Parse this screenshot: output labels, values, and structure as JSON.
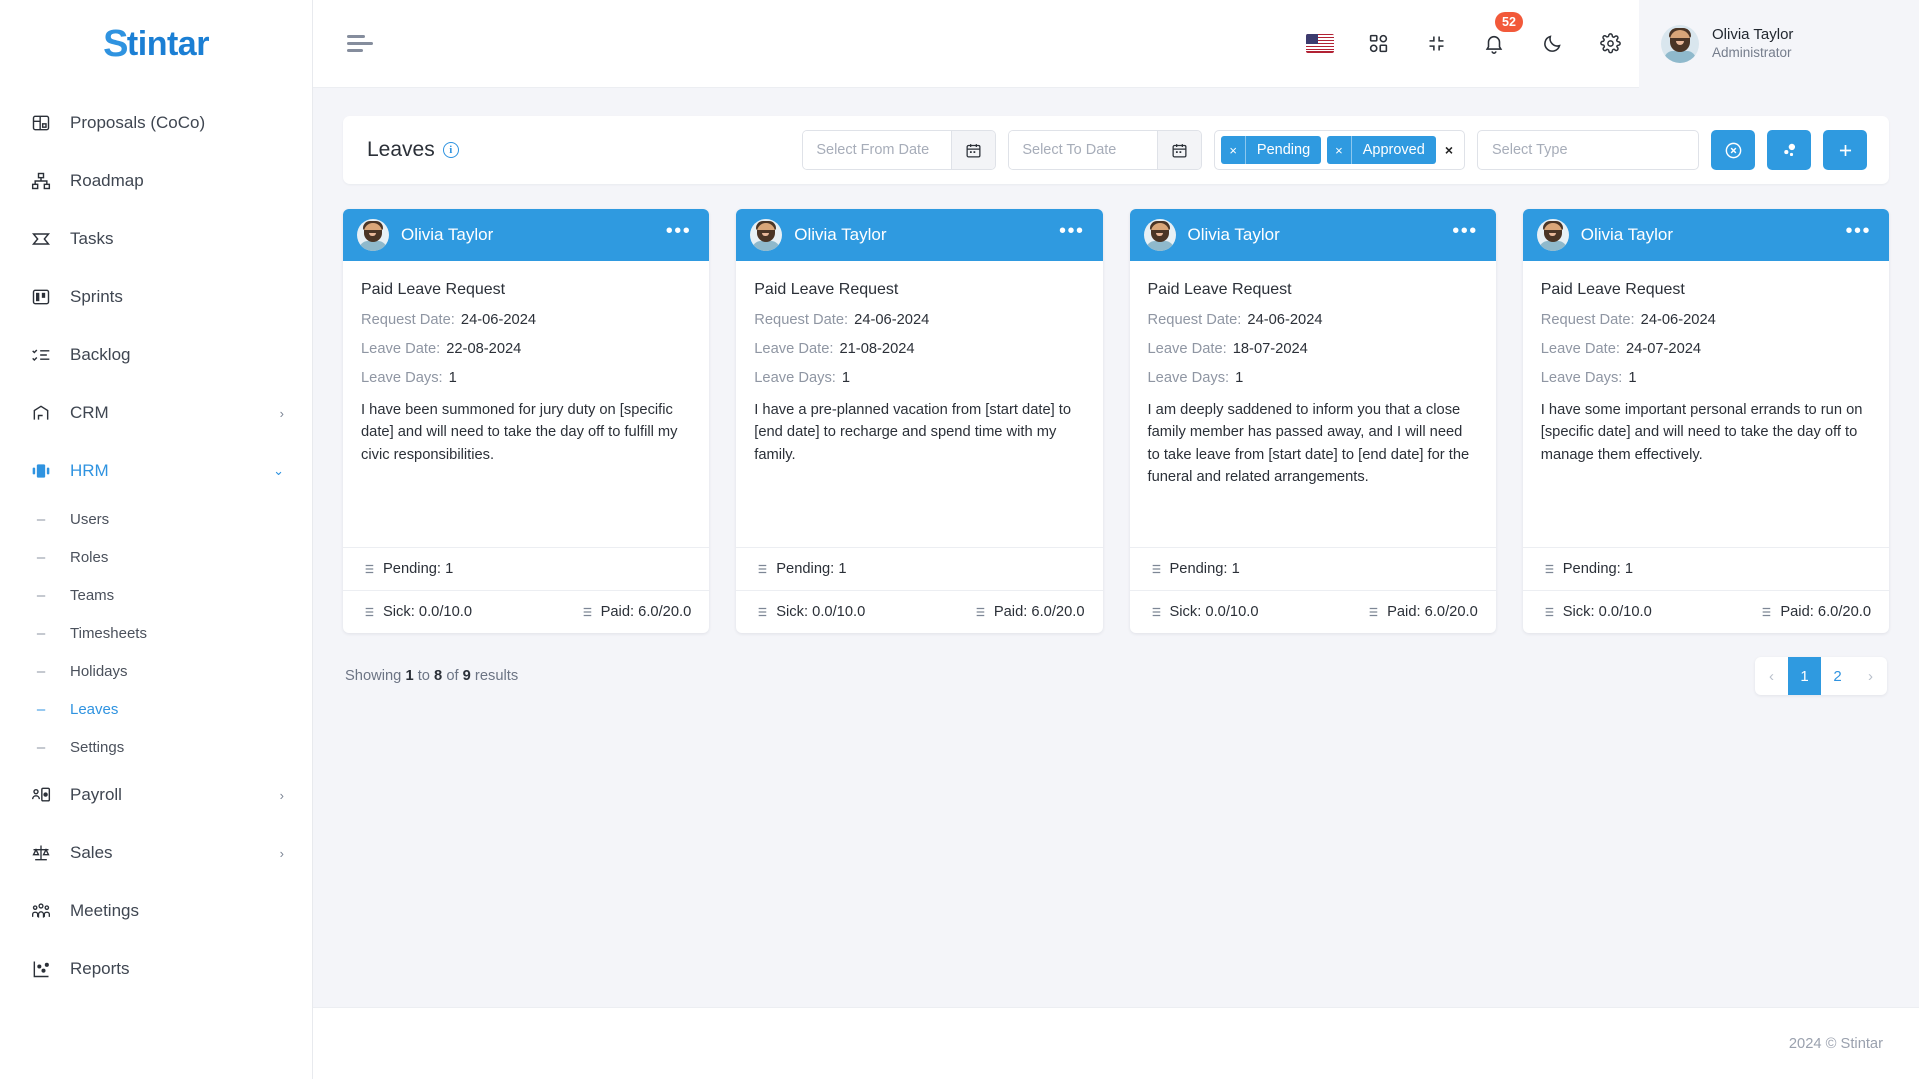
{
  "brand": {
    "name": "Stintar",
    "initial": "S",
    "rest": "tintar"
  },
  "sidebar": {
    "items": [
      {
        "label": "Proposals (CoCo)",
        "icon": "proposals-icon",
        "chevron": ""
      },
      {
        "label": "Roadmap",
        "icon": "roadmap-icon",
        "chevron": ""
      },
      {
        "label": "Tasks",
        "icon": "tasks-icon",
        "chevron": ""
      },
      {
        "label": "Sprints",
        "icon": "sprints-icon",
        "chevron": ""
      },
      {
        "label": "Backlog",
        "icon": "backlog-icon",
        "chevron": ""
      },
      {
        "label": "CRM",
        "icon": "crm-icon",
        "chevron": "›"
      },
      {
        "label": "HRM",
        "icon": "hrm-icon",
        "chevron": "⌄"
      }
    ],
    "hrm_children": [
      {
        "label": "Users"
      },
      {
        "label": "Roles"
      },
      {
        "label": "Teams"
      },
      {
        "label": "Timesheets"
      },
      {
        "label": "Holidays"
      },
      {
        "label": "Leaves"
      },
      {
        "label": "Settings"
      }
    ],
    "items_after": [
      {
        "label": "Payroll",
        "icon": "payroll-icon",
        "chevron": "›"
      },
      {
        "label": "Sales",
        "icon": "sales-icon",
        "chevron": "›"
      },
      {
        "label": "Meetings",
        "icon": "meetings-icon",
        "chevron": ""
      },
      {
        "label": "Reports",
        "icon": "reports-icon",
        "chevron": ""
      }
    ],
    "active_item": "HRM",
    "active_child": "Leaves"
  },
  "topbar": {
    "menu_toggle": "menu-toggle",
    "icons": [
      "flag-us-icon",
      "apps-grid-icon",
      "fullscreen-exit-icon",
      "bell-icon",
      "moon-icon",
      "gear-icon"
    ],
    "notification_count": "52",
    "user": {
      "name": "Olivia Taylor",
      "role": "Administrator"
    }
  },
  "filterbar": {
    "title": "Leaves",
    "info_glyph": "i",
    "from_date_placeholder": "Select From Date",
    "from_date_value": "",
    "to_date_placeholder": "Select To Date",
    "to_date_value": "",
    "status_chips": [
      {
        "label": "Pending",
        "remove": "×"
      },
      {
        "label": "Approved",
        "remove": "×"
      }
    ],
    "clear_all": "×",
    "type_placeholder": "Select Type",
    "type_value": "",
    "buttons": [
      {
        "name": "reset-filter-button",
        "icon": "circle-x-icon"
      },
      {
        "name": "group-filter-button",
        "icon": "bubbles-icon"
      },
      {
        "name": "add-leave-button",
        "icon": "plus-icon"
      }
    ],
    "accent": "#2f9ae0"
  },
  "cards": [
    {
      "user": "Olivia Taylor",
      "menu": "•••",
      "leave_type": "Paid Leave Request",
      "request_date_label": "Request Date:",
      "request_date": "24-06-2024",
      "leave_date_label": "Leave Date:",
      "leave_date": "22-08-2024",
      "leave_days_label": "Leave Days:",
      "leave_days": "1",
      "reason": "I have been summoned for jury duty on [specific date] and will need to take the day off to fulfill my civic responsibilities.",
      "pending": "Pending: 1",
      "sick": "Sick: 0.0/10.0",
      "paid": "Paid: 6.0/20.0"
    },
    {
      "user": "Olivia Taylor",
      "menu": "•••",
      "leave_type": "Paid Leave Request",
      "request_date_label": "Request Date:",
      "request_date": "24-06-2024",
      "leave_date_label": "Leave Date:",
      "leave_date": "21-08-2024",
      "leave_days_label": "Leave Days:",
      "leave_days": "1",
      "reason": "I have a pre-planned vacation from [start date] to [end date] to recharge and spend time with my family.",
      "pending": "Pending: 1",
      "sick": "Sick: 0.0/10.0",
      "paid": "Paid: 6.0/20.0"
    },
    {
      "user": "Olivia Taylor",
      "menu": "•••",
      "leave_type": "Paid Leave Request",
      "request_date_label": "Request Date:",
      "request_date": "24-06-2024",
      "leave_date_label": "Leave Date:",
      "leave_date": "18-07-2024",
      "leave_days_label": "Leave Days:",
      "leave_days": "1",
      "reason": "I am deeply saddened to inform you that a close family member has passed away, and I will need to take leave from [start date] to [end date] for the funeral and related arrangements.",
      "pending": "Pending: 1",
      "sick": "Sick: 0.0/10.0",
      "paid": "Paid: 6.0/20.0"
    },
    {
      "user": "Olivia Taylor",
      "menu": "•••",
      "leave_type": "Paid Leave Request",
      "request_date_label": "Request Date:",
      "request_date": "24-06-2024",
      "leave_date_label": "Leave Date:",
      "leave_date": "24-07-2024",
      "leave_days_label": "Leave Days:",
      "leave_days": "1",
      "reason": "I have some important personal errands to run on [specific date] and will need to take the day off to manage them effectively.",
      "pending": "Pending: 1",
      "sick": "Sick: 0.0/10.0",
      "paid": "Paid: 6.0/20.0"
    }
  ],
  "pagination": {
    "showing_prefix": "Showing",
    "from": "1",
    "mid": "to",
    "to": "8",
    "of": "of",
    "total": "9",
    "suffix": "results",
    "prev": "‹",
    "pages": [
      "1",
      "2"
    ],
    "current_page": "1",
    "next": "›"
  },
  "footer": {
    "copyright": "2024 © Stintar"
  }
}
